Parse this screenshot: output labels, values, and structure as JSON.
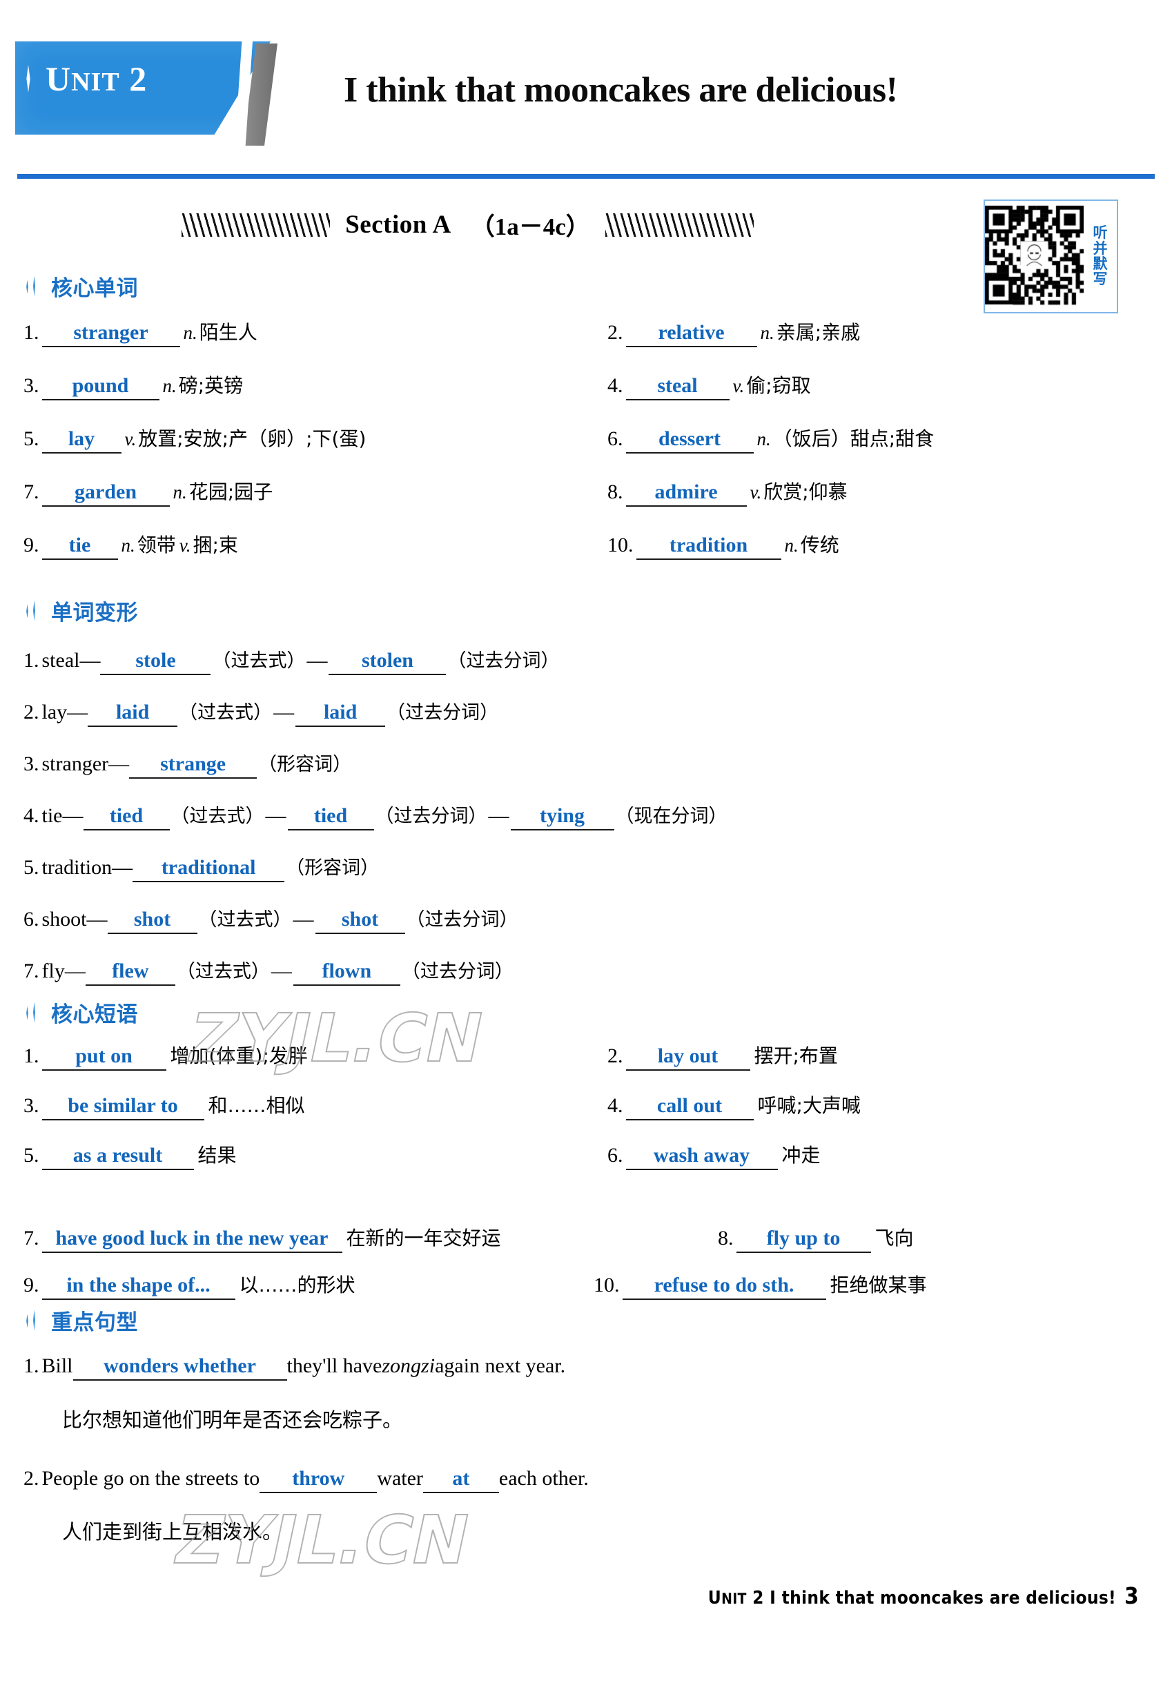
{
  "header": {
    "unit_prefix": "U",
    "unit_small": "NIT",
    "unit_number": "2",
    "unit_label_full": "UNIT 2",
    "title": "I think that mooncakes are delicious!",
    "accent_color": "#2a8ddb",
    "rule_color": "#1f6fd0"
  },
  "section_banner": {
    "label": "Section A",
    "range": "（1a－4c）"
  },
  "qr": {
    "caption_chars": [
      "听",
      "并",
      "默",
      "写"
    ],
    "border_color": "#7fb6e8",
    "text_color": "#1a6fc4"
  },
  "groups": {
    "core_words": "核心单词",
    "word_forms": "单词变形",
    "core_phrases": "核心短语",
    "key_sentences": "重点句型"
  },
  "core_words": [
    {
      "num": "1.",
      "answer": "stranger",
      "pos": "n.",
      "meaning": "陌生人"
    },
    {
      "num": "2.",
      "answer": "relative",
      "pos": "n.",
      "meaning": "亲属;亲戚"
    },
    {
      "num": "3.",
      "answer": "pound",
      "pos": "n.",
      "meaning": "磅;英镑"
    },
    {
      "num": "4.",
      "answer": "steal",
      "pos": "v.",
      "meaning": "偷;窃取"
    },
    {
      "num": "5.",
      "answer": "lay",
      "pos": "v.",
      "meaning": "放置;安放;产（卵）;下(蛋)"
    },
    {
      "num": "6.",
      "answer": "dessert",
      "pos": "n.",
      "meaning": "（饭后）甜点;甜食"
    },
    {
      "num": "7.",
      "answer": "garden",
      "pos": "n.",
      "meaning": "花园;园子"
    },
    {
      "num": "8.",
      "answer": "admire",
      "pos": "v.",
      "meaning": "欣赏;仰慕"
    },
    {
      "num": "9.",
      "answer": "tie",
      "pos": "n.",
      "meaning": "领带",
      "pos2": "v.",
      "meaning2": "捆;束"
    },
    {
      "num": "10.",
      "answer": "tradition",
      "pos": "n.",
      "meaning": "传统"
    }
  ],
  "word_forms": [
    {
      "num": "1.",
      "base": "steal—",
      "forms": [
        {
          "answer": "stole",
          "tag": "（过去式）"
        },
        {
          "answer": "stolen",
          "tag": "（过去分词）"
        }
      ]
    },
    {
      "num": "2.",
      "base": "lay—",
      "forms": [
        {
          "answer": "laid",
          "tag": "（过去式）"
        },
        {
          "answer": "laid",
          "tag": "（过去分词）"
        }
      ]
    },
    {
      "num": "3.",
      "base": "stranger—",
      "forms": [
        {
          "answer": "strange",
          "tag": "（形容词）"
        }
      ]
    },
    {
      "num": "4.",
      "base": "tie—",
      "forms": [
        {
          "answer": "tied",
          "tag": "（过去式）"
        },
        {
          "answer": "tied",
          "tag": "（过去分词）"
        },
        {
          "answer": "tying",
          "tag": "（现在分词）"
        }
      ]
    },
    {
      "num": "5.",
      "base": "tradition—",
      "forms": [
        {
          "answer": "traditional",
          "tag": "（形容词）"
        }
      ]
    },
    {
      "num": "6.",
      "base": "shoot—",
      "forms": [
        {
          "answer": "shot",
          "tag": "（过去式）"
        },
        {
          "answer": "shot",
          "tag": "（过去分词）"
        }
      ]
    },
    {
      "num": "7.",
      "base": "fly—",
      "forms": [
        {
          "answer": "flew",
          "tag": "（过去式）"
        },
        {
          "answer": "flown",
          "tag": "（过去分词）"
        }
      ]
    }
  ],
  "core_phrases": [
    {
      "num": "1.",
      "answer": "put on",
      "meaning": "增加(体重);发胖"
    },
    {
      "num": "2.",
      "answer": "lay out",
      "meaning": "摆开;布置"
    },
    {
      "num": "3.",
      "answer": "be similar to",
      "meaning": "和……相似"
    },
    {
      "num": "4.",
      "answer": "call out",
      "meaning": "呼喊;大声喊"
    },
    {
      "num": "5.",
      "answer": "as a result",
      "meaning": "结果"
    },
    {
      "num": "6.",
      "answer": "wash away",
      "meaning": "冲走"
    },
    {
      "num": "7.",
      "answer": "have good luck in the new year",
      "meaning": "在新的一年交好运"
    },
    {
      "num": "8.",
      "answer": "fly up to",
      "meaning": "飞向"
    },
    {
      "num": "9.",
      "answer": "in the shape of...",
      "meaning": "以……的形状"
    },
    {
      "num": "10.",
      "answer": "refuse to do sth.",
      "meaning": "拒绝做某事"
    }
  ],
  "key_sentences": [
    {
      "num": "1.",
      "pre": "Bill",
      "answer": "wonders whether",
      "post": "they'll have",
      "italic": "zongzi",
      "post2": "again next year.",
      "translation": "比尔想知道他们明年是否还会吃粽子。"
    },
    {
      "num": "2.",
      "pre": "People go on the streets to",
      "answer": "throw",
      "mid": "water",
      "answer2": "at",
      "post": "each other.",
      "translation": "人们走到街上互相泼水。"
    }
  ],
  "watermark": {
    "text": "ZYJL.CN"
  },
  "footer": {
    "unit_prefix": "U",
    "unit_small": "NIT",
    "text": "2 I think that mooncakes are delicious!",
    "page": "3"
  }
}
